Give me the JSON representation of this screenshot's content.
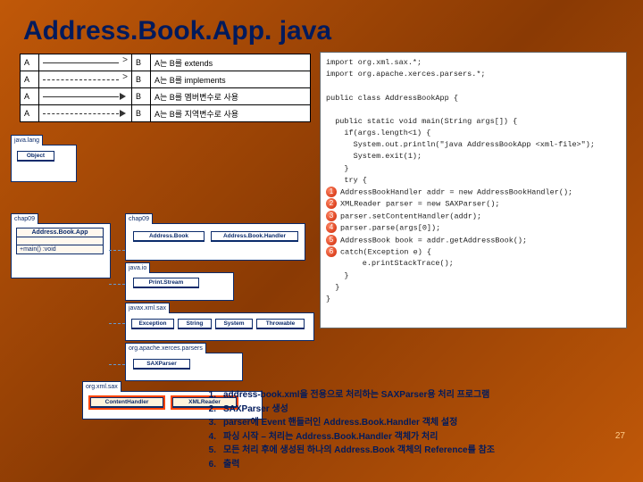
{
  "title": "Address.Book.App. java",
  "legend": [
    {
      "a": "A",
      "b": "B",
      "style": "solid-open",
      "desc": "A는 B를 extends"
    },
    {
      "a": "A",
      "b": "B",
      "style": "dashed-open",
      "desc": "A는 B를 implements"
    },
    {
      "a": "A",
      "b": "B",
      "style": "solid",
      "desc": "A는 B를 멤버변수로 사용"
    },
    {
      "a": "A",
      "b": "B",
      "style": "dashed",
      "desc": "A는 B를 지역변수로 사용"
    }
  ],
  "code": {
    "imports": [
      "import org.xml.sax.*;",
      "import org.apache.xerces.parsers.*;"
    ],
    "class_decl": "public class AddressBookApp {",
    "main_decl": "  public static void main(String args[]) {",
    "if_line": "    if(args.length<1) {",
    "out_line": "      System.out.println(\"java AddressBookApp <xml-file>\");",
    "exit_line": "      System.exit(1);",
    "brace1": "    }",
    "try_line": "    try {",
    "b1": "AddressBookHandler addr = new AddressBookHandler();",
    "b2": "XMLReader parser = new SAXParser();",
    "b3": "parser.setContentHandler(addr);",
    "b4": "parser.parse(args[0]);",
    "b5": "AddressBook book = addr.getAddressBook();",
    "b6_a": "catch(Exception e) {",
    "b6_b": "  e.printStackTrace();",
    "close1": "    }",
    "close2": "  }",
    "close3": "}"
  },
  "uml": {
    "pkg_javalang": "java.lang",
    "pkg_chap09_left": "chap09",
    "pkg_chap09_right": "chap09",
    "pkg_javaio": "java.io",
    "pkg_javaxsax": "javax.xml.sax",
    "pkg_xerces": "org.apache.xerces.parsers",
    "pkg_orgxmlsax": "org.xml.sax",
    "cls_object": "Object",
    "cls_app": "Address.Book.App",
    "cls_app_method": "+main() :void",
    "cls_abook": "Address.Book",
    "cls_handler": "Address.Book.Handler",
    "cls_print": "Print.Stream",
    "cls_exception": "Exception",
    "cls_string": "String",
    "cls_system": "System",
    "cls_throwable": "Throwable",
    "cls_saxparser": "SAXParser",
    "cls_contenthandler": "ContentHandler",
    "cls_xmlreader": "XMLReader"
  },
  "steps": [
    "address-book.xml을 전용으로 처리하는 SAXParser용 처리 프로그램",
    "SAXParser 생성",
    "parser에 Event 핸들러인 Address.Book.Handler 객체 설정",
    "파싱 시작 – 처리는 Address.Book.Handler 객체가 처리",
    "모든 처리 후에 생성된 하나의 Address.Book 객체의 Reference를 참조",
    "출력"
  ],
  "page": "27"
}
